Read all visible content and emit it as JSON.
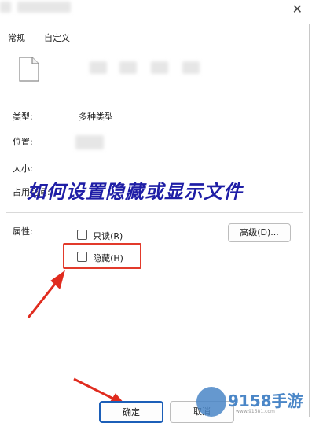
{
  "window": {
    "close_glyph": "✕"
  },
  "tabs": [
    {
      "label": "常规"
    },
    {
      "label": "自定义"
    }
  ],
  "file": {
    "icon": "file-icon"
  },
  "props": {
    "type_label": "类型:",
    "type_value": "多种类型",
    "location_label": "位置:",
    "size_label": "大小:",
    "disk_label": "占用空间:",
    "attr_label": "属性:"
  },
  "attributes": {
    "readonly_label": "只读(R)",
    "hidden_label": "隐藏(H)",
    "advanced_button": "高级(D)..."
  },
  "footer": {
    "ok_button": "确定",
    "cancel_button": "取消"
  },
  "overlay": {
    "title": "如何设置隐藏或显示文件"
  },
  "watermark": {
    "brand": "9158手游",
    "url": "www.91581.com"
  },
  "colors": {
    "annotation": "#e23a2b",
    "overlay_text": "#1f1ea6"
  }
}
